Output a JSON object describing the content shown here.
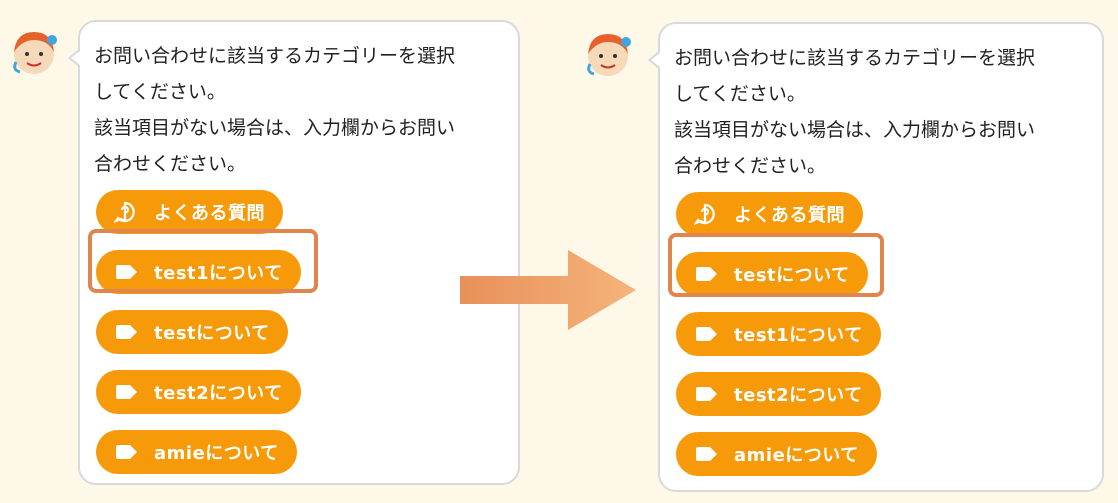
{
  "panels": [
    {
      "message": [
        "お問い合わせに該当するカテゴリーを選択",
        "してください。",
        "該当項目がない場合は、入力欄からお問い",
        "合わせください。"
      ],
      "options": [
        {
          "icon": "question-circle-icon",
          "label": "よくある質問"
        },
        {
          "icon": "tag-icon",
          "label": "test1について"
        },
        {
          "icon": "tag-icon",
          "label": "testについて"
        },
        {
          "icon": "tag-icon",
          "label": "test2について"
        },
        {
          "icon": "tag-icon",
          "label": "amieについて"
        }
      ],
      "highlighted_option": "test1について"
    },
    {
      "message": [
        "お問い合わせに該当するカテゴリーを選択",
        "してください。",
        "該当項目がない場合は、入力欄からお問い",
        "合わせください。"
      ],
      "options": [
        {
          "icon": "question-circle-icon",
          "label": "よくある質問"
        },
        {
          "icon": "tag-icon",
          "label": "testについて"
        },
        {
          "icon": "tag-icon",
          "label": "test1について"
        },
        {
          "icon": "tag-icon",
          "label": "test2について"
        },
        {
          "icon": "tag-icon",
          "label": "amieについて"
        }
      ],
      "highlighted_option": "testについて"
    }
  ],
  "colors": {
    "background": "#fdf8e8",
    "button": "#f79a0a",
    "highlight": "#e0854e",
    "arrow": "#f0a868"
  }
}
